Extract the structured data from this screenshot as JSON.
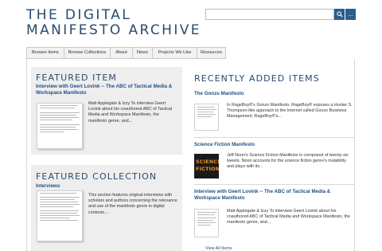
{
  "site": {
    "title": "THE DIGITAL MANIFESTO ARCHIVE",
    "search_placeholder": "",
    "search_more_label": "..."
  },
  "nav": {
    "tabs": [
      {
        "label": "Browse Items"
      },
      {
        "label": "Browse Collections"
      },
      {
        "label": "About"
      },
      {
        "label": "News"
      },
      {
        "label": "Projects We Like"
      },
      {
        "label": "Resources"
      }
    ]
  },
  "featured_item": {
    "heading": "FEATURED ITEM",
    "title": "Interview with Geert Lovink -- The ABC of Tactical Media & Workspace Manifesto",
    "description": "Matt Applegate & Izzy To interview Geert Lovink about his coauthored ABC of Tactical Media and Workspace Manifesto, the manifesto genre, and..."
  },
  "featured_collection": {
    "heading": "FEATURED COLLECTION",
    "title": "Interviews",
    "description": "This section features original interviews with scholars and authors concerning the relevance and use of the manifesto genre in digital contexts...."
  },
  "recent": {
    "heading": "RECENTLY ADDED ITEMS",
    "items": [
      {
        "title": "The Gonzo Manifesto",
        "description": "In RageBoy®'s Gonzo Manifesto, RageBoy® exposes a Hunter S. Thompson-like approach to the Internet called Gonzo Business Management; RageBoy®'s..."
      },
      {
        "title": "Science Fiction Manifesto",
        "description": "Jeff Noon's Science Fiction Manifesto is comprised of twenty-six tweets. Noon accounts for the science fiction genre's mutability and plays with its...",
        "thumb_line1": "SCIENCE",
        "thumb_line2": "FICTION"
      },
      {
        "title": "Interview with Geert Lovink -- The ABC of Tactical Media & Workspace Manifesto",
        "description": "Matt Applegate & Izzy To interview Geert Lovink about his coauthored ABC of Tactical Media and Workspace Manifesto, the manifesto genre, and..."
      }
    ],
    "view_all": "View All Items"
  },
  "colors": {
    "brand": "#2b4a6d",
    "link": "#1f4f86",
    "search_button": "#2a5e8c",
    "panel_bg": "#eeeeee"
  }
}
